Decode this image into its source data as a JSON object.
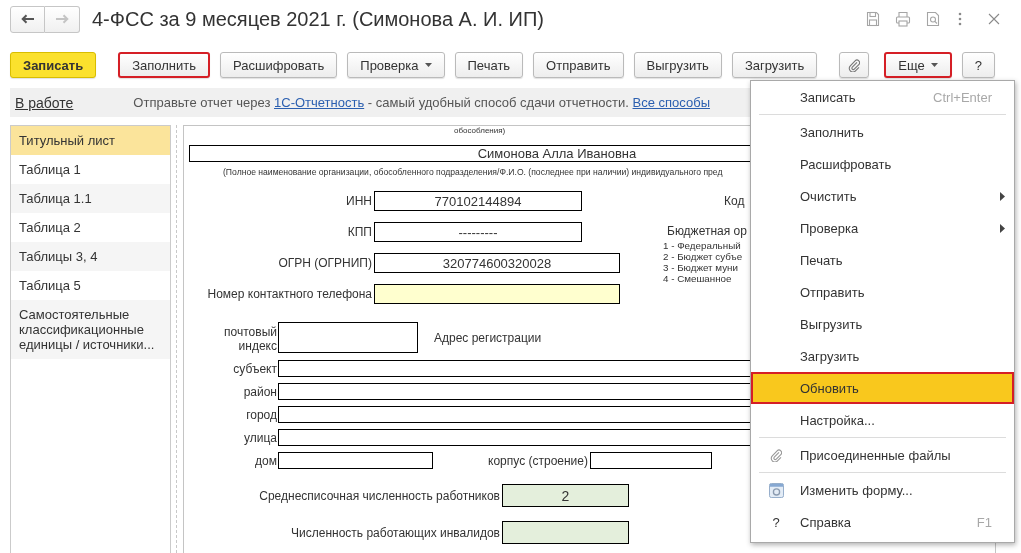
{
  "window": {
    "title": "4-ФСС за 9 месяцев 2021 г. (Симонова А. И. ИП)"
  },
  "nav": {
    "back": {
      "disabled": false
    },
    "forward": {
      "disabled": true
    }
  },
  "toolbar": {
    "left": [
      {
        "label": "Записать",
        "kind": "primary",
        "highlighted": false
      },
      {
        "label": "Заполнить",
        "kind": "button",
        "highlighted": true
      },
      {
        "label": "Расшифровать",
        "kind": "button",
        "highlighted": false
      },
      {
        "label": "Проверка",
        "kind": "dropdown",
        "highlighted": false
      },
      {
        "label": "Печать",
        "kind": "button",
        "highlighted": false
      },
      {
        "label": "Отправить",
        "kind": "button",
        "highlighted": false
      },
      {
        "label": "Выгрузить",
        "kind": "button",
        "highlighted": false
      },
      {
        "label": "Загрузить",
        "kind": "button",
        "highlighted": false
      },
      {
        "kind": "attach",
        "highlighted": false
      }
    ],
    "right": [
      {
        "label": "Еще",
        "kind": "dropdown",
        "highlighted": true
      },
      {
        "label": "?",
        "kind": "button",
        "highlighted": false
      }
    ]
  },
  "info_bar": {
    "status": "В работе",
    "message": [
      {
        "kind": "text",
        "text": "Отправьте отчет через "
      },
      {
        "kind": "link",
        "text": "1С-Отчетность"
      },
      {
        "kind": "text",
        "text": " - самый удобный способ сдачи отчетности. "
      },
      {
        "kind": "link",
        "text": "Все способы"
      }
    ]
  },
  "sidebar": {
    "items": [
      {
        "label": "Титульный лист",
        "selected": true
      },
      {
        "label": "Таблица 1",
        "selected": false
      },
      {
        "label": "Таблица 1.1",
        "selected": false
      },
      {
        "label": "Таблица 2",
        "selected": false
      },
      {
        "label": "Таблицы 3, 4",
        "selected": false
      },
      {
        "label": "Таблица 5",
        "selected": false
      },
      {
        "label": "Самостоятельные классификационные единицы / источники...",
        "selected": false
      }
    ]
  },
  "form": {
    "top_caption": "обособления)",
    "name_field": {
      "value": "Симонова Алла Ивановна"
    },
    "name_caption": "(Полное наименование организации, обособленного подразделения/Ф.И.О. (последнее при наличии) индивидуального пред",
    "id_fields": [
      {
        "label": "ИНН",
        "value": "770102144894",
        "kind": "auto"
      },
      {
        "label": "КПП",
        "value": "---------",
        "kind": "auto"
      },
      {
        "label": "ОГРН (ОГРНИП)",
        "value": "320774600320028",
        "kind": "auto"
      },
      {
        "label": "Номер контактного телефона",
        "kind": "input"
      }
    ],
    "code_label": "Код",
    "budget": {
      "heading": "Бюджетная ор",
      "options": [
        "1 - Федеральный",
        "2 - Бюджет субъе",
        "3 - Бюджет муни",
        "4 - Смешанное"
      ]
    },
    "address": {
      "postcode_label": "почтовый индекс",
      "heading": "Адрес регистрации",
      "lines": [
        {
          "label": "субъект"
        },
        {
          "label": "район"
        },
        {
          "label": "город"
        },
        {
          "label": "улица"
        }
      ],
      "house_label": "дом",
      "building_label": "корпус (строение)"
    },
    "counts": [
      {
        "label": "Среднесписочная численность работников",
        "value": "2",
        "kind": "calculated"
      },
      {
        "label": "Численность работающих инвалидов",
        "kind": "calculated"
      }
    ]
  },
  "menu": {
    "groups": [
      {
        "items": [
          {
            "label": "Записать",
            "kind": "command",
            "shortcut": "Ctrl+Enter",
            "selected": false,
            "highlighted": false
          }
        ]
      },
      {
        "items": [
          {
            "label": "Заполнить",
            "kind": "command",
            "selected": false,
            "highlighted": false
          },
          {
            "label": "Расшифровать",
            "kind": "command",
            "selected": false,
            "highlighted": false
          },
          {
            "label": "Очистить",
            "kind": "submenu",
            "selected": false,
            "highlighted": false
          },
          {
            "label": "Проверка",
            "kind": "submenu",
            "selected": false,
            "highlighted": false
          },
          {
            "label": "Печать",
            "kind": "command",
            "selected": false,
            "highlighted": false
          },
          {
            "label": "Отправить",
            "kind": "command",
            "selected": false,
            "highlighted": false
          },
          {
            "label": "Выгрузить",
            "kind": "command",
            "selected": false,
            "highlighted": false
          },
          {
            "label": "Загрузить",
            "kind": "command",
            "selected": false,
            "highlighted": false
          },
          {
            "label": "Обновить",
            "kind": "command",
            "selected": true,
            "highlighted": true
          },
          {
            "label": "Настройка...",
            "kind": "command",
            "selected": false,
            "highlighted": false
          }
        ]
      },
      {
        "items": [
          {
            "label": "Присоединенные файлы",
            "kind": "attach",
            "selected": false,
            "highlighted": false
          }
        ]
      },
      {
        "items": [
          {
            "label": "Изменить форму...",
            "kind": "customize",
            "selected": false,
            "highlighted": false
          },
          {
            "label": "Справка",
            "kind": "help",
            "icon_text": "?",
            "shortcut": "F1",
            "selected": false,
            "highlighted": false
          }
        ]
      }
    ]
  }
}
